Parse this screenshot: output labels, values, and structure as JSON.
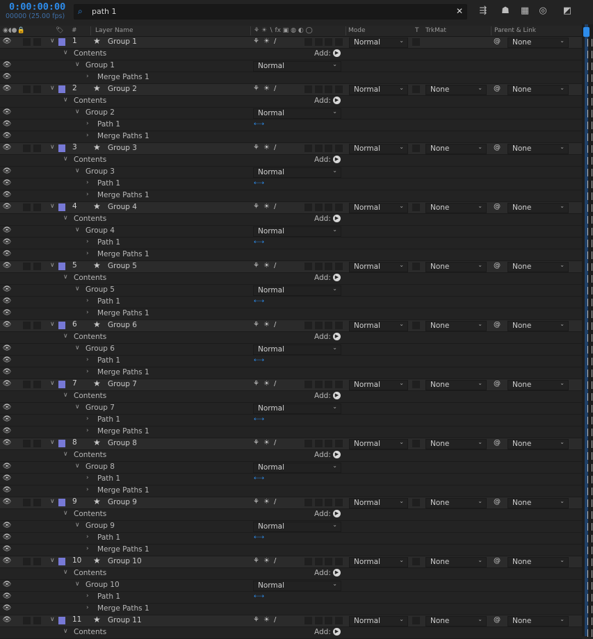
{
  "header": {
    "timecode": "0:00:00:00",
    "frame_info": "00000 (25.00 fps)",
    "search_value": "path 1",
    "search_clear_glyph": "✕"
  },
  "columns": {
    "number": "#",
    "layer_name": "Layer Name",
    "mode": "Mode",
    "t": "T",
    "trkmat": "TrkMat",
    "parent_link": "Parent & Link"
  },
  "labels": {
    "contents": "Contents",
    "add": "Add:",
    "path": "Path 1",
    "merge": "Merge Paths 1"
  },
  "colors": {
    "accent": "#2d8ceb",
    "layer_label": "#7779d6"
  },
  "layers": [
    {
      "number": "1",
      "name": "Group 1",
      "mode": "Normal",
      "trkmat": "",
      "parent": "None",
      "group_name": "Group 1",
      "group_mode": "Normal",
      "has_path": false
    },
    {
      "number": "2",
      "name": "Group 2",
      "mode": "Normal",
      "trkmat": "None",
      "parent": "None",
      "group_name": "Group 2",
      "group_mode": "Normal",
      "has_path": true
    },
    {
      "number": "3",
      "name": "Group 3",
      "mode": "Normal",
      "trkmat": "None",
      "parent": "None",
      "group_name": "Group 3",
      "group_mode": "Normal",
      "has_path": true
    },
    {
      "number": "4",
      "name": "Group 4",
      "mode": "Normal",
      "trkmat": "None",
      "parent": "None",
      "group_name": "Group 4",
      "group_mode": "Normal",
      "has_path": true
    },
    {
      "number": "5",
      "name": "Group 5",
      "mode": "Normal",
      "trkmat": "None",
      "parent": "None",
      "group_name": "Group 5",
      "group_mode": "Normal",
      "has_path": true
    },
    {
      "number": "6",
      "name": "Group 6",
      "mode": "Normal",
      "trkmat": "None",
      "parent": "None",
      "group_name": "Group 6",
      "group_mode": "Normal",
      "has_path": true
    },
    {
      "number": "7",
      "name": "Group 7",
      "mode": "Normal",
      "trkmat": "None",
      "parent": "None",
      "group_name": "Group 7",
      "group_mode": "Normal",
      "has_path": true
    },
    {
      "number": "8",
      "name": "Group 8",
      "mode": "Normal",
      "trkmat": "None",
      "parent": "None",
      "group_name": "Group 8",
      "group_mode": "Normal",
      "has_path": true
    },
    {
      "number": "9",
      "name": "Group 9",
      "mode": "Normal",
      "trkmat": "None",
      "parent": "None",
      "group_name": "Group 9",
      "group_mode": "Normal",
      "has_path": true
    },
    {
      "number": "10",
      "name": "Group 10",
      "mode": "Normal",
      "trkmat": "None",
      "parent": "None",
      "group_name": "Group 10",
      "group_mode": "Normal",
      "has_path": true
    },
    {
      "number": "11",
      "name": "Group 11",
      "mode": "Normal",
      "trkmat": "None",
      "parent": "None",
      "group_name": "",
      "group_mode": "",
      "has_path": false
    }
  ]
}
